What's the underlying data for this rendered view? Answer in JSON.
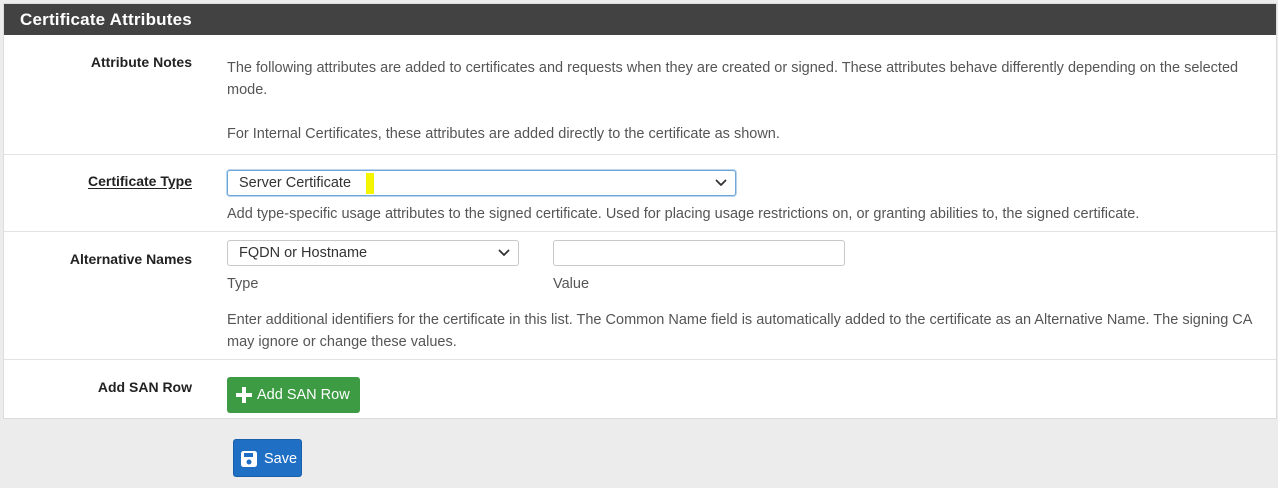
{
  "panel": {
    "title": "Certificate Attributes"
  },
  "attribute_notes": {
    "label": "Attribute Notes",
    "text1": "The following attributes are added to certificates and requests when they are created or signed. These attributes behave differently depending on the selected mode.",
    "text2": "For Internal Certificates, these attributes are added directly to the certificate as shown."
  },
  "certificate_type": {
    "label": "Certificate Type",
    "selected": "Server Certificate",
    "help": "Add type-specific usage attributes to the signed certificate. Used for placing usage restrictions on, or granting abilities to, the signed certificate."
  },
  "alternative_names": {
    "label": "Alternative Names",
    "type_selected": "FQDN or Hostname",
    "type_label": "Type",
    "value": "",
    "value_label": "Value",
    "help": "Enter additional identifiers for the certificate in this list. The Common Name field is automatically added to the certificate as an Alternative Name. The signing CA may ignore or change these values."
  },
  "add_san_row": {
    "label": "Add SAN Row",
    "button_label": "Add SAN Row"
  },
  "save": {
    "button_label": "Save"
  },
  "colors": {
    "header_bg": "#424242",
    "add_button": "#3c9b43",
    "save_button": "#1f6fc5",
    "highlight": "#f5f500"
  },
  "icons": {
    "add": "plus-icon",
    "save": "floppy-disk-icon",
    "dropdown": "chevron-down-icon"
  }
}
